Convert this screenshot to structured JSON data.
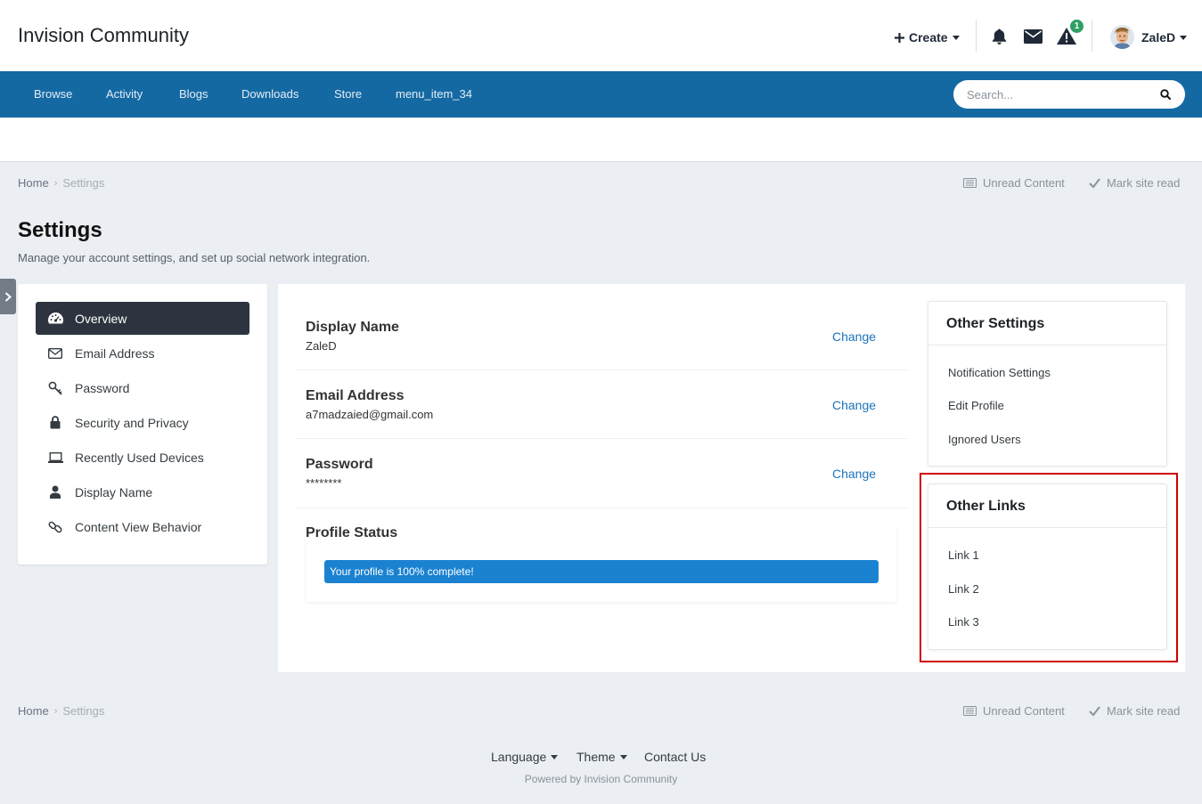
{
  "header": {
    "logo": "Invision Community",
    "create_label": "Create",
    "notification_count": "1",
    "username": "ZaleD"
  },
  "nav": {
    "items": [
      "Browse",
      "Activity",
      "Blogs",
      "Downloads",
      "Store",
      "menu_item_34"
    ],
    "search_placeholder": "Search..."
  },
  "breadcrumb": {
    "home": "Home",
    "current": "Settings",
    "unread": "Unread Content",
    "mark_read": "Mark site read"
  },
  "page": {
    "title": "Settings",
    "description": "Manage your account settings, and set up social network integration."
  },
  "settings_menu": [
    {
      "label": "Overview",
      "icon": "dashboard-icon"
    },
    {
      "label": "Email Address",
      "icon": "envelope-icon"
    },
    {
      "label": "Password",
      "icon": "key-icon"
    },
    {
      "label": "Security and Privacy",
      "icon": "lock-icon"
    },
    {
      "label": "Recently Used Devices",
      "icon": "laptop-icon"
    },
    {
      "label": "Display Name",
      "icon": "user-icon"
    },
    {
      "label": "Content View Behavior",
      "icon": "link-icon"
    }
  ],
  "overview": {
    "display_name_label": "Display Name",
    "display_name_value": "ZaleD",
    "email_label": "Email Address",
    "email_value": "a7madzaied@gmail.com",
    "password_label": "Password",
    "password_value": "********",
    "change_label": "Change",
    "profile_status_label": "Profile Status",
    "profile_complete_text": "Your profile is 100% complete!",
    "profile_complete_fraction": 1.0
  },
  "other_settings": {
    "title": "Other Settings",
    "links": [
      "Notification Settings",
      "Edit Profile",
      "Ignored Users"
    ]
  },
  "other_links": {
    "title": "Other Links",
    "links": [
      "Link 1",
      "Link 2",
      "Link 3"
    ]
  },
  "footer": {
    "language": "Language",
    "theme": "Theme",
    "contact": "Contact Us",
    "powered": "Powered by Invision Community"
  },
  "colors": {
    "nav_bg": "#1569a3",
    "link": "#1b73bc",
    "progress": "#1b82d1",
    "active_menu": "#2d3440",
    "highlight_box": "#cc0000",
    "badge": "#2e9f64"
  }
}
